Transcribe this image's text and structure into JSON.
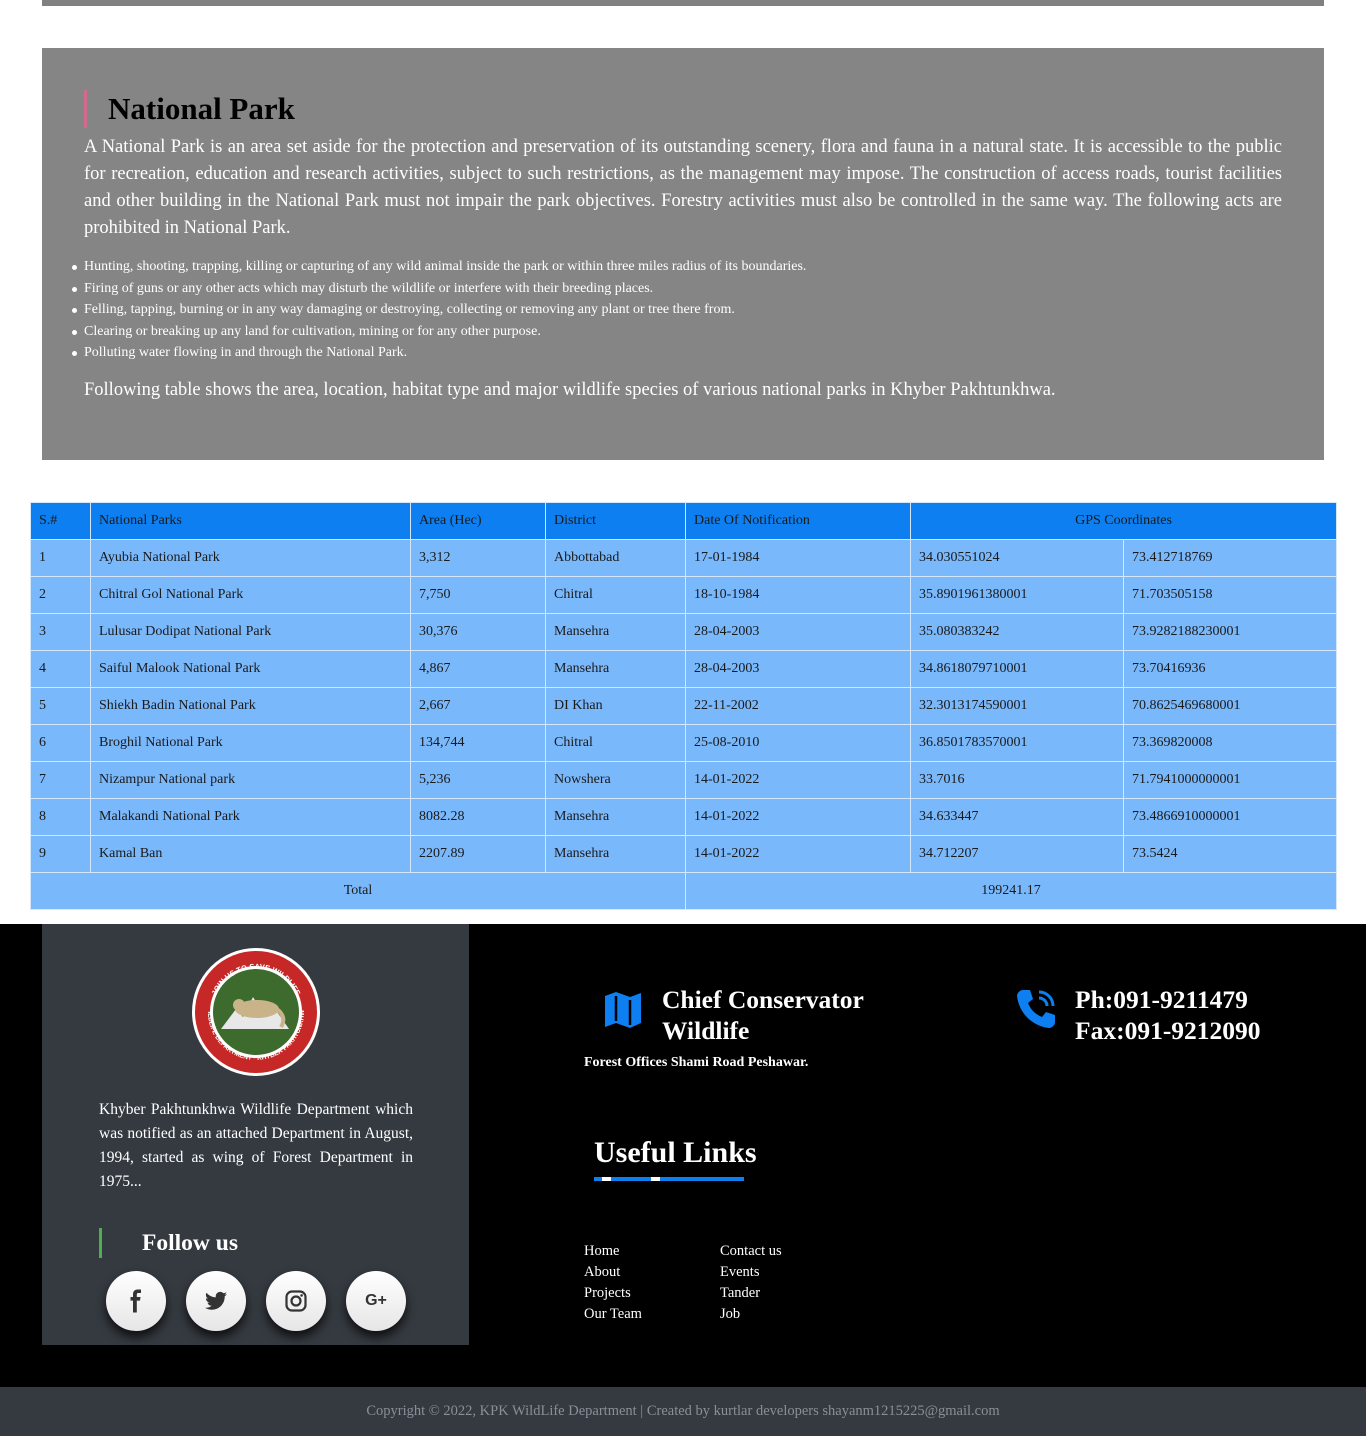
{
  "intro": {
    "title": "National Park",
    "text": "A National Park is an area set aside for the protection and preservation of its outstanding scenery, flora and fauna in a natural state. It is accessible to the public for recreation, education and research activities, subject to such restrictions, as the management may impose. The construction of access roads, tourist facilities and other building in the National Park must not impair the park objectives. Forestry activities must also be controlled in the same way. The following acts are prohibited in National Park.",
    "prohibited": [
      "Hunting, shooting, trapping, killing or capturing of any wild animal inside the park or within three miles radius of its boundaries.",
      "Firing of guns or any other acts which may disturb the wildlife or interfere with their breeding places.",
      "Felling, tapping, burning or in any way damaging or destroying, collecting or removing any plant or tree there from.",
      "Clearing or breaking up any land for cultivation, mining or for any other purpose.",
      "Polluting water flowing in and through the National Park."
    ],
    "footer": "Following table shows the area, location, habitat type and major wildlife species of various national parks in Khyber Pakhtunkhwa."
  },
  "table": {
    "headers": [
      "S.#",
      "National Parks",
      "Area (Hec)",
      "District",
      "Date Of Notification",
      "GPS Coordinates"
    ],
    "rows": [
      [
        "1",
        "Ayubia National Park",
        "3,312",
        "Abbottabad",
        "17-01-1984",
        "34.030551024",
        "73.412718769"
      ],
      [
        "2",
        "Chitral Gol National Park",
        "7,750",
        "Chitral",
        "18-10-1984",
        "35.8901961380001",
        "71.703505158"
      ],
      [
        "3",
        "Lulusar Dodipat National Park",
        "30,376",
        "Mansehra",
        "28-04-2003",
        "35.080383242",
        "73.9282188230001"
      ],
      [
        "4",
        "Saiful Malook National Park",
        "4,867",
        "Mansehra",
        "28-04-2003",
        "34.8618079710001",
        "73.70416936"
      ],
      [
        "5",
        "Shiekh Badin National Park",
        "2,667",
        "DI Khan",
        "22-11-2002",
        "32.3013174590001",
        "70.8625469680001"
      ],
      [
        "6",
        "Broghil National Park",
        "134,744",
        "Chitral",
        "25-08-2010",
        "36.8501783570001",
        "73.369820008"
      ],
      [
        "7",
        "Nizampur National park",
        "5,236",
        "Nowshera",
        "14-01-2022",
        "33.7016",
        "71.7941000000001"
      ],
      [
        "8",
        "Malakandi National Park",
        "8082.28",
        "Mansehra",
        "14-01-2022",
        "34.633447",
        "73.4866910000001"
      ],
      [
        "9",
        "Kamal Ban",
        "2207.89",
        "Mansehra",
        "14-01-2022",
        "34.712207",
        "73.5424"
      ]
    ],
    "total_label": "Total",
    "total_value": "199241.17"
  },
  "footer": {
    "logo_text_top": "JOIN US TO SAVE WILDLIFE",
    "logo_text_bottom": "WILDLIFE DEPARTMENT · KHYBER PAKHTUNKHWA",
    "about": "Khyber Pakhtunkhwa Wildlife Department which was notified as an attached Department in August, 1994, started as wing of Forest Department in 1975...",
    "follow_title": "Follow us",
    "socials": [
      {
        "name": "facebook-icon",
        "glyph": "f"
      },
      {
        "name": "twitter-icon",
        "glyph": ""
      },
      {
        "name": "instagram-icon",
        "glyph": ""
      },
      {
        "name": "google-plus-icon",
        "glyph": "G+"
      }
    ],
    "address_title_line1": "Chief Conservator",
    "address_title_line2": "Wildlife",
    "address_sub": "Forest Offices Shami Road Peshawar.",
    "phone": "Ph:091-9211479",
    "fax": "Fax:091-9212090",
    "links_title": "Useful Links",
    "links_col1": [
      "Home",
      "About",
      "Projects",
      "Our Team"
    ],
    "links_col2": [
      "Contact us",
      "Events",
      "Tander",
      "Job"
    ],
    "accent": "#0d7ff0"
  },
  "copyright": "Copyright © 2022, KPK WildLife Department | Created by kurtlar developers shayanm1215225@gmail.com"
}
